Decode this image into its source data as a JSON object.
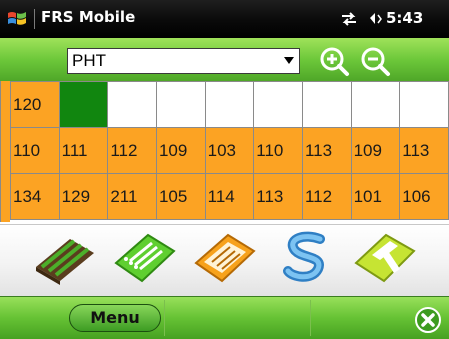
{
  "status_bar": {
    "app_title": "FRS Mobile",
    "time": "5:43",
    "icons": [
      "windows-flag-icon",
      "sync-arrows-icon",
      "speaker-icon"
    ]
  },
  "toolbar": {
    "dropdown": {
      "selected": "PHT"
    },
    "icons": [
      "zoom-in-icon",
      "zoom-out-icon"
    ]
  },
  "grid": {
    "rows": [
      [
        {
          "text": "120",
          "color": "orange"
        },
        {
          "text": "",
          "color": "green"
        },
        {
          "text": "",
          "color": "white"
        },
        {
          "text": "",
          "color": "white"
        },
        {
          "text": "",
          "color": "white"
        },
        {
          "text": "",
          "color": "white"
        },
        {
          "text": "",
          "color": "white"
        },
        {
          "text": "",
          "color": "white"
        },
        {
          "text": "",
          "color": "white"
        }
      ],
      [
        {
          "text": "110",
          "color": "orange"
        },
        {
          "text": "111",
          "color": "orange"
        },
        {
          "text": "112",
          "color": "orange"
        },
        {
          "text": "109",
          "color": "orange"
        },
        {
          "text": "103",
          "color": "orange"
        },
        {
          "text": "110",
          "color": "orange"
        },
        {
          "text": "113",
          "color": "orange"
        },
        {
          "text": "109",
          "color": "orange"
        },
        {
          "text": "113",
          "color": "orange"
        }
      ],
      [
        {
          "text": "134",
          "color": "orange"
        },
        {
          "text": "129",
          "color": "orange"
        },
        {
          "text": "211",
          "color": "orange"
        },
        {
          "text": "105",
          "color": "orange"
        },
        {
          "text": "114",
          "color": "orange"
        },
        {
          "text": "113",
          "color": "orange"
        },
        {
          "text": "112",
          "color": "orange"
        },
        {
          "text": "101",
          "color": "orange"
        },
        {
          "text": "106",
          "color": "orange"
        }
      ]
    ]
  },
  "tools": [
    "field-rows-icon",
    "list-sheet-icon",
    "notes-sheet-icon",
    "s-path-icon",
    "t-tool-icon"
  ],
  "bottom_bar": {
    "menu_label": "Menu",
    "close_icon": "close-circle-icon"
  },
  "colors": {
    "accent_green": "#66c234",
    "cell_orange": "#fca323",
    "cell_green": "#11860f"
  }
}
